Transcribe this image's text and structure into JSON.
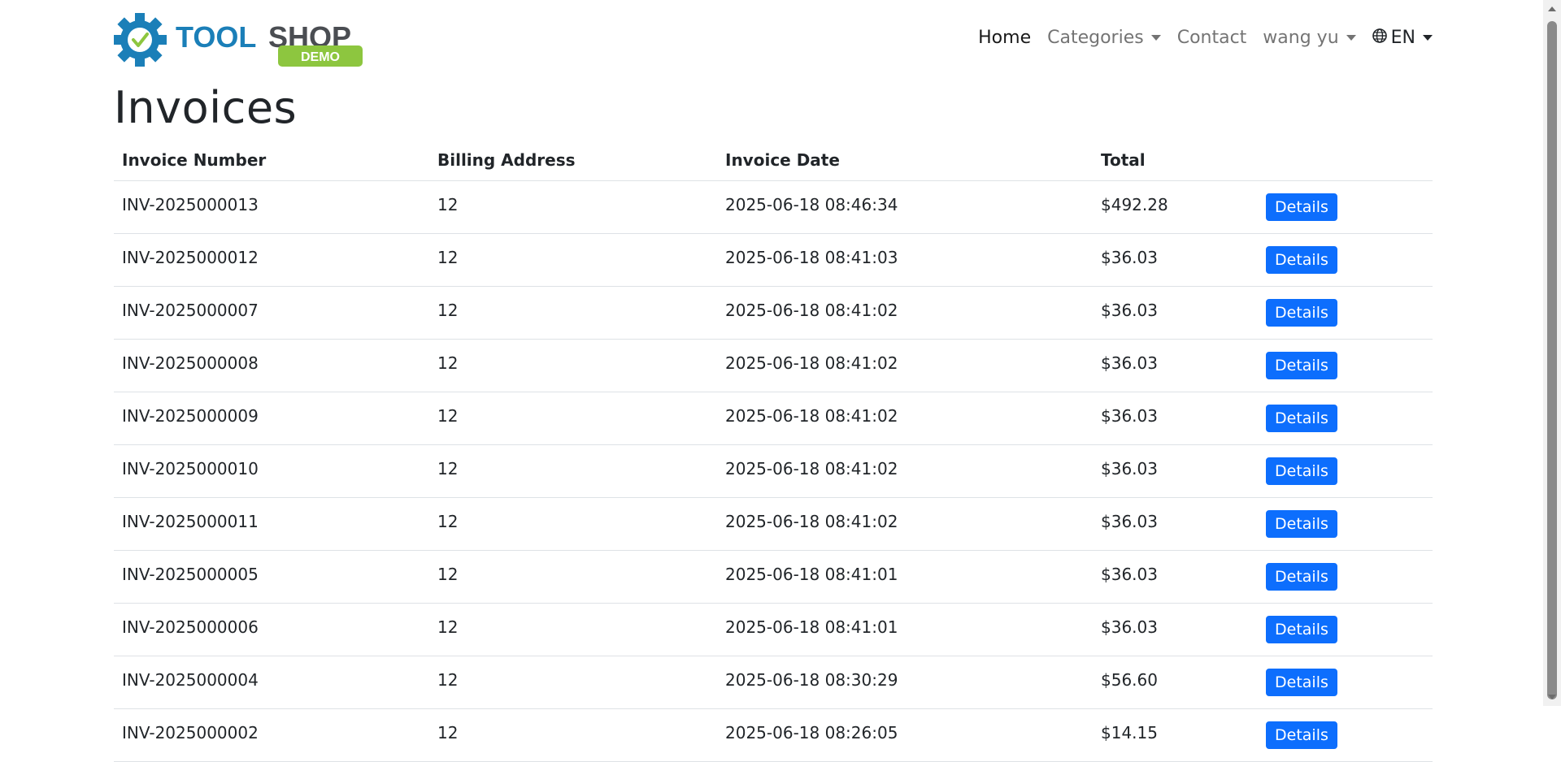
{
  "brand": {
    "name_part1": "TOOL",
    "name_part2": "SHOP",
    "badge": "DEMO"
  },
  "nav": {
    "home": "Home",
    "categories": "Categories",
    "contact": "Contact",
    "user": "wang yu",
    "language": "EN"
  },
  "page_title": "Invoices",
  "table": {
    "headers": {
      "invoice_number": "Invoice Number",
      "billing_address": "Billing Address",
      "invoice_date": "Invoice Date",
      "total": "Total"
    },
    "button_label": "Details",
    "rows": [
      {
        "number": "INV-2025000013",
        "address": "12",
        "date": "2025-06-18 08:46:34",
        "total": "$492.28"
      },
      {
        "number": "INV-2025000012",
        "address": "12",
        "date": "2025-06-18 08:41:03",
        "total": "$36.03"
      },
      {
        "number": "INV-2025000007",
        "address": "12",
        "date": "2025-06-18 08:41:02",
        "total": "$36.03"
      },
      {
        "number": "INV-2025000008",
        "address": "12",
        "date": "2025-06-18 08:41:02",
        "total": "$36.03"
      },
      {
        "number": "INV-2025000009",
        "address": "12",
        "date": "2025-06-18 08:41:02",
        "total": "$36.03"
      },
      {
        "number": "INV-2025000010",
        "address": "12",
        "date": "2025-06-18 08:41:02",
        "total": "$36.03"
      },
      {
        "number": "INV-2025000011",
        "address": "12",
        "date": "2025-06-18 08:41:02",
        "total": "$36.03"
      },
      {
        "number": "INV-2025000005",
        "address": "12",
        "date": "2025-06-18 08:41:01",
        "total": "$36.03"
      },
      {
        "number": "INV-2025000006",
        "address": "12",
        "date": "2025-06-18 08:41:01",
        "total": "$36.03"
      },
      {
        "number": "INV-2025000004",
        "address": "12",
        "date": "2025-06-18 08:30:29",
        "total": "$56.60"
      },
      {
        "number": "INV-2025000002",
        "address": "12",
        "date": "2025-06-18 08:26:05",
        "total": "$14.15"
      }
    ]
  },
  "colors": {
    "primary": "#0d6efd",
    "brand_blue": "#1b7fb8",
    "brand_gray": "#4a4d52",
    "badge_green": "#8dc63f"
  }
}
